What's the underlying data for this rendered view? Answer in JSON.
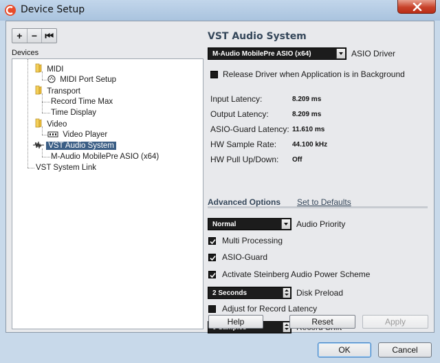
{
  "window": {
    "title": "Device Setup"
  },
  "toolbar": {
    "add": "+",
    "remove": "−",
    "reset": "⏮"
  },
  "devices": {
    "header": "Devices",
    "items": [
      {
        "label": "MIDI",
        "icon": "folder-icon"
      },
      {
        "label": "MIDI Port Setup",
        "icon": "midi-port-icon"
      },
      {
        "label": "Transport",
        "icon": "folder-icon"
      },
      {
        "label": "Record Time Max",
        "icon": ""
      },
      {
        "label": "Time Display",
        "icon": ""
      },
      {
        "label": "Video",
        "icon": "folder-icon"
      },
      {
        "label": "Video Player",
        "icon": "video-icon"
      },
      {
        "label": "VST Audio System",
        "icon": "audio-icon",
        "selected": true
      },
      {
        "label": "M-Audio MobilePre ASIO (x64)",
        "icon": ""
      },
      {
        "label": "VST System Link",
        "icon": ""
      }
    ]
  },
  "vst": {
    "title": "VST Audio System",
    "asio_driver_value": "M-Audio MobilePre ASIO (x64)",
    "asio_driver_label": "ASIO Driver",
    "release_driver_label": "Release Driver when Application is in Background",
    "release_driver_checked": false,
    "stats": [
      {
        "label": "Input Latency:",
        "value": "8.209 ms"
      },
      {
        "label": "Output Latency:",
        "value": "8.209 ms"
      },
      {
        "label": "ASIO-Guard Latency:",
        "value": "11.610 ms"
      },
      {
        "label": "HW Sample Rate:",
        "value": "44.100 kHz"
      },
      {
        "label": "HW Pull Up/Down:",
        "value": "Off"
      }
    ],
    "advanced_tab": "Advanced Options",
    "defaults_tab": "Set to Defaults",
    "audio_priority_value": "Normal",
    "audio_priority_label": "Audio Priority",
    "multi_processing_label": "Multi Processing",
    "multi_processing_checked": true,
    "asio_guard_label": "ASIO-Guard",
    "asio_guard_checked": true,
    "power_scheme_label": "Activate Steinberg Audio Power Scheme",
    "power_scheme_checked": true,
    "disk_preload_value": "2 Seconds",
    "disk_preload_label": "Disk Preload",
    "adjust_latency_label": "Adjust for Record Latency",
    "adjust_latency_checked": false,
    "record_shift_value": "0 Samples",
    "record_shift_label": "Record Shift",
    "help_button": "Help",
    "reset_button": "Reset",
    "apply_button": "Apply"
  },
  "footer": {
    "ok_button": "OK",
    "cancel_button": "Cancel"
  }
}
